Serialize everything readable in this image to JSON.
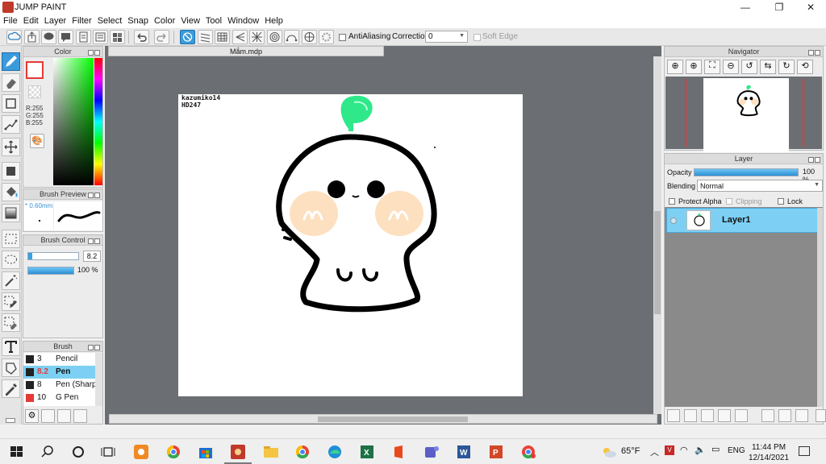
{
  "window": {
    "title": "JUMP PAINT",
    "controls": [
      "—",
      "❐",
      "✕"
    ]
  },
  "menu": [
    "File",
    "Edit",
    "Layer",
    "Filter",
    "Select",
    "Snap",
    "Color",
    "View",
    "Tool",
    "Window",
    "Help"
  ],
  "toolbar": {
    "antialiasing_label": "AntiAliasing",
    "correction_label": "Correction",
    "correction_value": "0",
    "softedge_label": "Soft Edge"
  },
  "color_panel": {
    "title": "Color",
    "r": "R:255",
    "g": "G:255",
    "b": "B:255"
  },
  "brush_preview": {
    "title": "Brush Preview",
    "size": "* 0.60mm"
  },
  "brush_control": {
    "title": "Brush Control",
    "size_value": "8.2",
    "opacity_value": "100 %",
    "opacity_fraction": 1.0
  },
  "brush_list": {
    "title": "Brush",
    "items": [
      {
        "size": "3",
        "name": "Pencil",
        "selected": false,
        "swatch": "#222222"
      },
      {
        "size": "8.2",
        "name": "Pen",
        "selected": true,
        "swatch": "#222222"
      },
      {
        "size": "8",
        "name": "Pen (Sharp",
        "selected": false,
        "swatch": "#222222"
      },
      {
        "size": "10",
        "name": "G Pen",
        "selected": false,
        "swatch": "#e53935"
      }
    ]
  },
  "document": {
    "tab_title": "Mắm.mdp"
  },
  "canvas_text": {
    "line1": "kazumiko14",
    "line2": "HD247"
  },
  "navigator": {
    "title": "Navigator"
  },
  "layer_panel": {
    "title": "Layer",
    "opacity_label": "Opacity",
    "opacity_value": "100 %",
    "opacity_fraction": 1.0,
    "blending_label": "Blending",
    "blending_value": "Normal",
    "protect_alpha": "Protect Alpha",
    "clipping": "Clipping",
    "lock": "Lock",
    "layers": [
      {
        "name": "Layer1"
      }
    ]
  },
  "taskbar": {
    "weather": "65°F",
    "language": "ENG",
    "time": "11:44 PM",
    "date": "12/14/2021"
  },
  "colors": {
    "accent": "#3a9bdc",
    "canvas_bg": "#6b6e72",
    "sprout": "#2ee88a",
    "blush": "#fde0bf"
  }
}
